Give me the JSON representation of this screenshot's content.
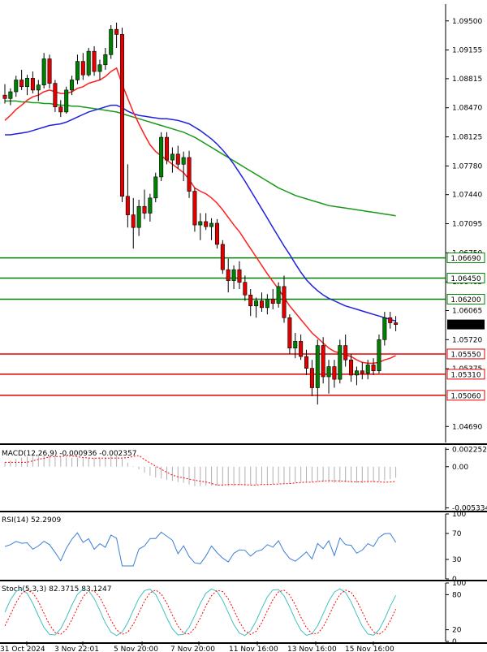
{
  "chart_data": {
    "type": "candlestick",
    "symbol_price_label": "1.05896",
    "y_ticks": [
      "1.09500",
      "1.09155",
      "1.08815",
      "1.08470",
      "1.08125",
      "1.07780",
      "1.07440",
      "1.07095",
      "1.06750",
      "1.06405",
      "1.06065",
      "1.05720",
      "1.05375",
      "1.04690"
    ],
    "x_ticks": [
      "31 Oct 2024",
      "3 Nov 22:01",
      "5 Nov 20:00",
      "7 Nov 20:00",
      "11 Nov 16:00",
      "13 Nov 16:00",
      "15 Nov 16:00"
    ],
    "ylim": [
      1.045,
      1.097
    ],
    "levels": [
      {
        "value": 1.0669,
        "label": "1.06690",
        "color": "#008000"
      },
      {
        "value": 1.0645,
        "label": "1.06450",
        "color": "#008000"
      },
      {
        "value": 1.062,
        "label": "1.06200",
        "color": "#008000"
      },
      {
        "value": 1.0555,
        "label": "1.05550",
        "color": "#e00000"
      },
      {
        "value": 1.0531,
        "label": "1.05310",
        "color": "#e00000"
      },
      {
        "value": 1.0506,
        "label": "1.05060",
        "color": "#e00000"
      }
    ],
    "candles": [
      {
        "o": 1.0862,
        "h": 1.0875,
        "l": 1.0852,
        "c": 1.0858
      },
      {
        "o": 1.0858,
        "h": 1.087,
        "l": 1.085,
        "c": 1.0866
      },
      {
        "o": 1.0866,
        "h": 1.0885,
        "l": 1.086,
        "c": 1.088
      },
      {
        "o": 1.088,
        "h": 1.0892,
        "l": 1.0868,
        "c": 1.0872
      },
      {
        "o": 1.0872,
        "h": 1.0886,
        "l": 1.0862,
        "c": 1.0882
      },
      {
        "o": 1.0882,
        "h": 1.089,
        "l": 1.0864,
        "c": 1.0868
      },
      {
        "o": 1.0868,
        "h": 1.088,
        "l": 1.0855,
        "c": 1.0874
      },
      {
        "o": 1.0874,
        "h": 1.0912,
        "l": 1.087,
        "c": 1.0905
      },
      {
        "o": 1.0905,
        "h": 1.091,
        "l": 1.087,
        "c": 1.0876
      },
      {
        "o": 1.0876,
        "h": 1.088,
        "l": 1.0842,
        "c": 1.0848
      },
      {
        "o": 1.0848,
        "h": 1.0856,
        "l": 1.0836,
        "c": 1.0842
      },
      {
        "o": 1.0842,
        "h": 1.0872,
        "l": 1.084,
        "c": 1.0868
      },
      {
        "o": 1.0868,
        "h": 1.0885,
        "l": 1.0862,
        "c": 1.088
      },
      {
        "o": 1.088,
        "h": 1.091,
        "l": 1.0875,
        "c": 1.0902
      },
      {
        "o": 1.0902,
        "h": 1.0912,
        "l": 1.088,
        "c": 1.0886
      },
      {
        "o": 1.0886,
        "h": 1.0918,
        "l": 1.0884,
        "c": 1.0914
      },
      {
        "o": 1.0914,
        "h": 1.092,
        "l": 1.0885,
        "c": 1.089
      },
      {
        "o": 1.089,
        "h": 1.0904,
        "l": 1.088,
        "c": 1.0898
      },
      {
        "o": 1.0898,
        "h": 1.0918,
        "l": 1.0892,
        "c": 1.091
      },
      {
        "o": 1.091,
        "h": 1.0945,
        "l": 1.0905,
        "c": 1.094
      },
      {
        "o": 1.094,
        "h": 1.0948,
        "l": 1.0918,
        "c": 1.0934
      },
      {
        "o": 1.0934,
        "h": 1.0942,
        "l": 1.0735,
        "c": 1.0742
      },
      {
        "o": 1.0742,
        "h": 1.078,
        "l": 1.0705,
        "c": 1.072
      },
      {
        "o": 1.072,
        "h": 1.074,
        "l": 1.068,
        "c": 1.0705
      },
      {
        "o": 1.0705,
        "h": 1.0738,
        "l": 1.0695,
        "c": 1.073
      },
      {
        "o": 1.073,
        "h": 1.075,
        "l": 1.0715,
        "c": 1.0722
      },
      {
        "o": 1.0722,
        "h": 1.0745,
        "l": 1.0712,
        "c": 1.074
      },
      {
        "o": 1.074,
        "h": 1.077,
        "l": 1.0735,
        "c": 1.0765
      },
      {
        "o": 1.0765,
        "h": 1.0818,
        "l": 1.076,
        "c": 1.0812
      },
      {
        "o": 1.0812,
        "h": 1.0818,
        "l": 1.078,
        "c": 1.0785
      },
      {
        "o": 1.0785,
        "h": 1.08,
        "l": 1.077,
        "c": 1.0792
      },
      {
        "o": 1.0792,
        "h": 1.0802,
        "l": 1.0775,
        "c": 1.078
      },
      {
        "o": 1.078,
        "h": 1.0795,
        "l": 1.076,
        "c": 1.0788
      },
      {
        "o": 1.0788,
        "h": 1.0796,
        "l": 1.074,
        "c": 1.0748
      },
      {
        "o": 1.0748,
        "h": 1.0752,
        "l": 1.07,
        "c": 1.0708
      },
      {
        "o": 1.0708,
        "h": 1.0722,
        "l": 1.069,
        "c": 1.0712
      },
      {
        "o": 1.0712,
        "h": 1.0722,
        "l": 1.0702,
        "c": 1.0706
      },
      {
        "o": 1.0706,
        "h": 1.0716,
        "l": 1.069,
        "c": 1.071
      },
      {
        "o": 1.071,
        "h": 1.0715,
        "l": 1.068,
        "c": 1.0685
      },
      {
        "o": 1.0685,
        "h": 1.069,
        "l": 1.065,
        "c": 1.0655
      },
      {
        "o": 1.0655,
        "h": 1.0668,
        "l": 1.0628,
        "c": 1.0642
      },
      {
        "o": 1.0642,
        "h": 1.066,
        "l": 1.0632,
        "c": 1.0655
      },
      {
        "o": 1.0655,
        "h": 1.0665,
        "l": 1.0632,
        "c": 1.064
      },
      {
        "o": 1.064,
        "h": 1.0648,
        "l": 1.0618,
        "c": 1.0625
      },
      {
        "o": 1.0625,
        "h": 1.0632,
        "l": 1.06,
        "c": 1.0612
      },
      {
        "o": 1.0612,
        "h": 1.0622,
        "l": 1.0598,
        "c": 1.0618
      },
      {
        "o": 1.0618,
        "h": 1.0628,
        "l": 1.0605,
        "c": 1.061
      },
      {
        "o": 1.061,
        "h": 1.0626,
        "l": 1.0602,
        "c": 1.062
      },
      {
        "o": 1.062,
        "h": 1.0632,
        "l": 1.0608,
        "c": 1.0615
      },
      {
        "o": 1.0615,
        "h": 1.064,
        "l": 1.061,
        "c": 1.0635
      },
      {
        "o": 1.0635,
        "h": 1.0648,
        "l": 1.0592,
        "c": 1.0598
      },
      {
        "o": 1.0598,
        "h": 1.0602,
        "l": 1.0555,
        "c": 1.0562
      },
      {
        "o": 1.0562,
        "h": 1.058,
        "l": 1.055,
        "c": 1.057
      },
      {
        "o": 1.057,
        "h": 1.0578,
        "l": 1.0548,
        "c": 1.0552
      },
      {
        "o": 1.0552,
        "h": 1.056,
        "l": 1.053,
        "c": 1.0538
      },
      {
        "o": 1.0538,
        "h": 1.0548,
        "l": 1.0505,
        "c": 1.0515
      },
      {
        "o": 1.0515,
        "h": 1.0572,
        "l": 1.0495,
        "c": 1.0565
      },
      {
        "o": 1.0565,
        "h": 1.0575,
        "l": 1.052,
        "c": 1.0528
      },
      {
        "o": 1.0528,
        "h": 1.0548,
        "l": 1.0508,
        "c": 1.054
      },
      {
        "o": 1.054,
        "h": 1.0548,
        "l": 1.0515,
        "c": 1.0525
      },
      {
        "o": 1.0525,
        "h": 1.0572,
        "l": 1.052,
        "c": 1.0565
      },
      {
        "o": 1.0565,
        "h": 1.0578,
        "l": 1.054,
        "c": 1.0548
      },
      {
        "o": 1.0548,
        "h": 1.0555,
        "l": 1.0522,
        "c": 1.053
      },
      {
        "o": 1.053,
        "h": 1.054,
        "l": 1.0518,
        "c": 1.0535
      },
      {
        "o": 1.0535,
        "h": 1.0545,
        "l": 1.0525,
        "c": 1.0532
      },
      {
        "o": 1.0532,
        "h": 1.0548,
        "l": 1.0525,
        "c": 1.0542
      },
      {
        "o": 1.0542,
        "h": 1.055,
        "l": 1.053,
        "c": 1.0535
      },
      {
        "o": 1.0535,
        "h": 1.0578,
        "l": 1.0532,
        "c": 1.0572
      },
      {
        "o": 1.0572,
        "h": 1.0605,
        "l": 1.0565,
        "c": 1.0598
      },
      {
        "o": 1.0598,
        "h": 1.0605,
        "l": 1.0585,
        "c": 1.0592
      },
      {
        "o": 1.0592,
        "h": 1.06,
        "l": 1.0582,
        "c": 1.059
      }
    ],
    "ma_red": [
      1.0832,
      1.0838,
      1.0845,
      1.085,
      1.0856,
      1.086,
      1.0862,
      1.0866,
      1.0868,
      1.0866,
      1.0864,
      1.0864,
      1.0866,
      1.087,
      1.0872,
      1.0876,
      1.0878,
      1.088,
      1.0884,
      1.089,
      1.0894,
      1.0875,
      1.0858,
      1.0842,
      1.0828,
      1.0815,
      1.0803,
      1.0795,
      1.079,
      1.0785,
      1.078,
      1.0775,
      1.077,
      1.0762,
      1.0752,
      1.0748,
      1.0745,
      1.074,
      1.0734,
      1.0726,
      1.0717,
      1.0708,
      1.07,
      1.069,
      1.068,
      1.067,
      1.066,
      1.065,
      1.0641,
      1.0632,
      1.0622,
      1.0612,
      1.0604,
      1.0596,
      1.0588,
      1.058,
      1.0574,
      1.0568,
      1.0562,
      1.0558,
      1.0556,
      1.0554,
      1.0552,
      1.0548,
      1.0545,
      1.0544,
      1.0544,
      1.0545,
      1.0548,
      1.055,
      1.0553
    ],
    "ma_blue": [
      1.0815,
      1.0815,
      1.0816,
      1.0817,
      1.0818,
      1.082,
      1.0822,
      1.0824,
      1.0826,
      1.0827,
      1.0828,
      1.083,
      1.0833,
      1.0836,
      1.0839,
      1.0842,
      1.0844,
      1.0846,
      1.0848,
      1.085,
      1.085,
      1.0847,
      1.0843,
      1.084,
      1.0838,
      1.0837,
      1.0836,
      1.0835,
      1.0834,
      1.0834,
      1.0833,
      1.0832,
      1.083,
      1.0828,
      1.0824,
      1.082,
      1.0815,
      1.081,
      1.0804,
      1.0797,
      1.0789,
      1.078,
      1.077,
      1.076,
      1.0749,
      1.0738,
      1.0727,
      1.0716,
      1.0705,
      1.0694,
      1.0683,
      1.0673,
      1.0662,
      1.0652,
      1.0643,
      1.0636,
      1.063,
      1.0625,
      1.0621,
      1.0618,
      1.0615,
      1.0612,
      1.061,
      1.0608,
      1.0606,
      1.0604,
      1.0602,
      1.06,
      1.0598,
      1.0596,
      1.0594
    ],
    "ma_green": [
      1.0855,
      1.0855,
      1.0855,
      1.0854,
      1.0854,
      1.0853,
      1.0853,
      1.0852,
      1.0852,
      1.0851,
      1.085,
      1.085,
      1.0849,
      1.0849,
      1.0848,
      1.0847,
      1.0846,
      1.0845,
      1.0844,
      1.0843,
      1.0842,
      1.084,
      1.0838,
      1.0836,
      1.0834,
      1.0832,
      1.083,
      1.0828,
      1.0826,
      1.0824,
      1.0822,
      1.082,
      1.0818,
      1.0815,
      1.0812,
      1.0808,
      1.0804,
      1.08,
      1.0796,
      1.0792,
      1.0788,
      1.0784,
      1.078,
      1.0776,
      1.0772,
      1.0768,
      1.0764,
      1.076,
      1.0756,
      1.0752,
      1.0749,
      1.0746,
      1.0743,
      1.0741,
      1.0739,
      1.0737,
      1.0735,
      1.0733,
      1.0731,
      1.073,
      1.0729,
      1.0728,
      1.0727,
      1.0726,
      1.0725,
      1.0724,
      1.0723,
      1.0722,
      1.0721,
      1.072,
      1.0719
    ],
    "ma_green_start_index": 0,
    "macd": {
      "title": "MACD(12,26,9) -0.000936 -0.002357",
      "y_ticks": [
        "0.002252",
        "0.00",
        "-0.005334"
      ],
      "ylim": [
        -0.0056,
        0.0025
      ]
    },
    "rsi": {
      "title": "RSI(14) 52.2909",
      "y_ticks": [
        "100",
        "70",
        "30",
        "0"
      ],
      "ylim": [
        0,
        100
      ]
    },
    "stoch": {
      "title": "Stoch(5,3,3) 82.3715 83.1247",
      "y_ticks": [
        "100",
        "80",
        "20",
        "0"
      ],
      "ylim": [
        0,
        100
      ]
    },
    "colors": {
      "bull": "#008000",
      "bear": "#e00000",
      "ma_red": "#ff2020",
      "ma_blue": "#2020e0",
      "ma_green": "#1a9a1a",
      "macd_signal": "#ff0000",
      "macd_hist": "#b0b0b0",
      "rsi_line": "#3a7fd5",
      "stoch_main": "#40c0c0",
      "stoch_signal": "#ff0000"
    }
  }
}
